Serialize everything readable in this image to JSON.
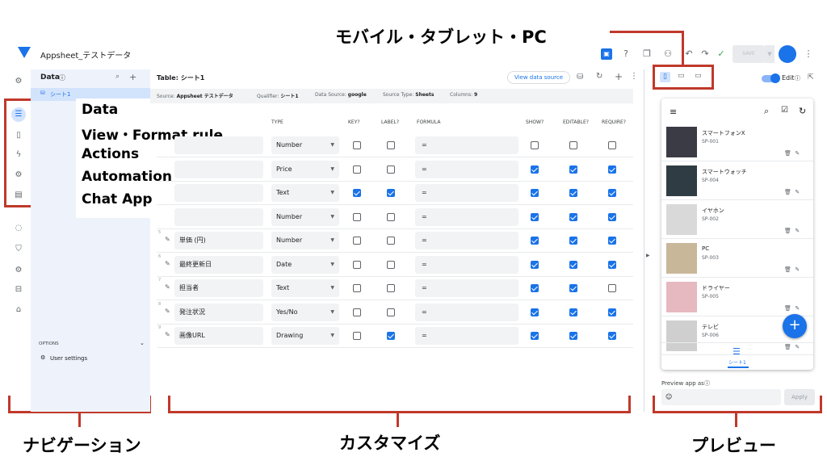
{
  "callouts": {
    "top": "モバイル・タブレット・PC",
    "navigation": "ナビゲーション",
    "customize": "カスタマイズ",
    "preview": "プレビュー"
  },
  "annotation_labels": [
    "Data",
    "View・Format rule",
    "Actions",
    "Automation",
    "Chat App"
  ],
  "app": {
    "title": "Appsheet_テストデータ",
    "save_label": "SAVE"
  },
  "nav": {
    "header": "Data",
    "selected_table": "シート1",
    "options_label": "OPTIONS",
    "user_settings": "User settings"
  },
  "main": {
    "table_title": "Table: シート1",
    "view_data_source": "View data source",
    "meta": {
      "source_label": "Source:",
      "source_value": "Appsheet テストデータ",
      "qualifier_label": "Qualifier:",
      "qualifier_value": "シート1",
      "datasource_label": "Data Source:",
      "datasource_value": "google",
      "sourcetype_label": "Source Type:",
      "sourcetype_value": "Sheets",
      "columns_label": "Columns:",
      "columns_value": "9"
    },
    "columns": {
      "type": "TYPE",
      "key": "KEY?",
      "label": "LABEL?",
      "formula": "FORMULA",
      "show": "SHOW?",
      "editable": "EDITABLE?",
      "require": "REQUIRE?"
    },
    "rows": [
      {
        "num": "",
        "name": "",
        "type": "Number",
        "formula": "=",
        "key": false,
        "label": false,
        "show": false,
        "editable": false,
        "require": false
      },
      {
        "num": "",
        "name": "",
        "type": "Price",
        "formula": "=",
        "key": false,
        "label": false,
        "show": true,
        "editable": true,
        "require": true
      },
      {
        "num": "",
        "name": "",
        "type": "Text",
        "formula": "=",
        "key": true,
        "label": true,
        "show": true,
        "editable": true,
        "require": true
      },
      {
        "num": "",
        "name": "",
        "type": "Number",
        "formula": "=",
        "key": false,
        "label": false,
        "show": true,
        "editable": true,
        "require": true
      },
      {
        "num": "5",
        "name": "単価 (円)",
        "type": "Number",
        "formula": "=",
        "key": false,
        "label": false,
        "show": true,
        "editable": true,
        "require": true
      },
      {
        "num": "6",
        "name": "最終更新日",
        "type": "Date",
        "formula": "=",
        "key": false,
        "label": false,
        "show": true,
        "editable": true,
        "require": true
      },
      {
        "num": "7",
        "name": "担当者",
        "type": "Text",
        "formula": "=",
        "key": false,
        "label": false,
        "show": true,
        "editable": true,
        "require": false
      },
      {
        "num": "8",
        "name": "発注状況",
        "type": "Yes/No",
        "formula": "=",
        "key": false,
        "label": false,
        "show": true,
        "editable": true,
        "require": true
      },
      {
        "num": "9",
        "name": "画像URL",
        "type": "Drawing",
        "formula": "=",
        "key": false,
        "label": true,
        "show": true,
        "editable": true,
        "require": true
      }
    ]
  },
  "preview": {
    "edit_label": "Edit",
    "items": [
      {
        "name": "スマートフォンX",
        "id": "SP-001",
        "color": "#3b3b46"
      },
      {
        "name": "スマートウォッチ",
        "id": "SP-004",
        "color": "#2f3c44"
      },
      {
        "name": "イヤホン",
        "id": "SP-002",
        "color": "#d9d9d9"
      },
      {
        "name": "PC",
        "id": "SP-003",
        "color": "#c9b79a"
      },
      {
        "name": "ドライヤー",
        "id": "SP-005",
        "color": "#e6b8c0"
      },
      {
        "name": "テレビ",
        "id": "SP-006",
        "color": "#cfcfcf"
      }
    ],
    "tab_label": "シート1",
    "preview_as": "Preview app as",
    "apply": "Apply"
  }
}
